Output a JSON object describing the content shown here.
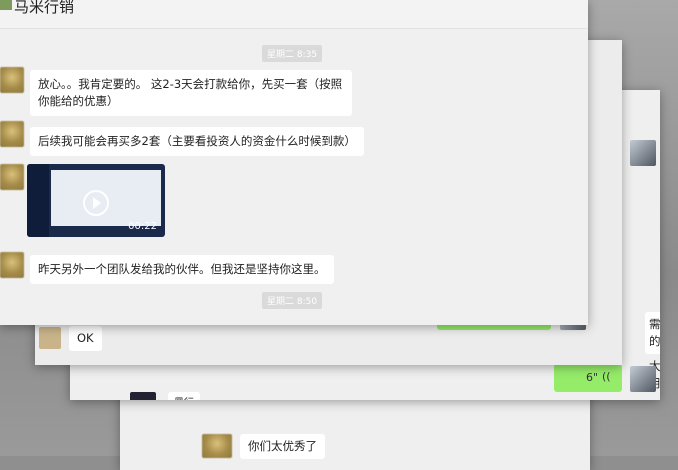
{
  "window_top": {
    "title": "马米行销",
    "time_1": "星期二 8:35",
    "time_2": "星期二 8:50",
    "messages": [
      {
        "text": "放心。。我肯定要的。 这2-3天会打款给你，先买一套（按照你能给的优惠）"
      },
      {
        "text": "后续我可能会再买多2套（主要看投资人的资金什么时候到款）"
      },
      {
        "text": "昨天另外一个团队发给我的伙伴。但我还是坚持你这里。"
      }
    ],
    "video": {
      "duration": "00:22"
    }
  },
  "window_2": {
    "ok_text": "OK"
  },
  "window_3": {
    "voice_duration": "6\"",
    "voice_icon": "voice-wave-icon",
    "name_text": "黑行",
    "edge_text_1": "需的",
    "edge_text_2": "太用"
  },
  "window_4": {
    "message": "你们太优秀了"
  },
  "colors": {
    "green_bubble": "#95ec69",
    "white_bubble": "#ffffff",
    "bg": "#f0f0f0"
  }
}
